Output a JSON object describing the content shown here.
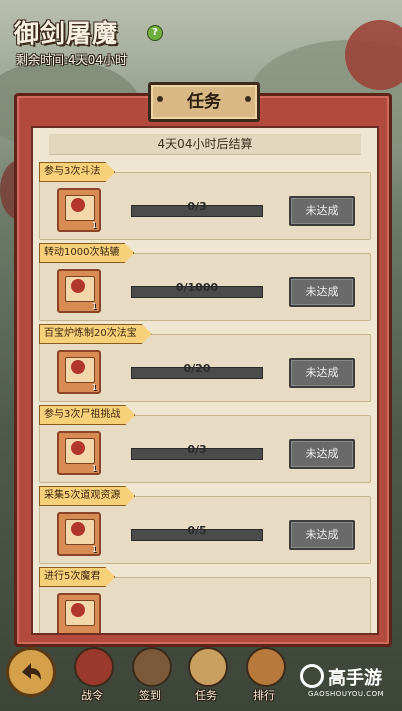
{
  "header": {
    "game_title": "御剑屠魔",
    "help_icon": "?",
    "remaining_time": "剩余时间:4天04小时"
  },
  "panel": {
    "title": "任务",
    "settle_text": "4天04小时后结算"
  },
  "tasks": [
    {
      "label": "参与3次斗法",
      "reward_qty": "1",
      "progress": "0/3",
      "button": "未达成"
    },
    {
      "label": "转动1000次轱辘",
      "reward_qty": "1",
      "progress": "0/1000",
      "button": "未达成"
    },
    {
      "label": "百宝炉炼制20次法宝",
      "reward_qty": "1",
      "progress": "0/20",
      "button": "未达成"
    },
    {
      "label": "参与3次尸祖挑战",
      "reward_qty": "1",
      "progress": "0/3",
      "button": "未达成"
    },
    {
      "label": "采集5次道观资源",
      "reward_qty": "1",
      "progress": "0/5",
      "button": "未达成"
    },
    {
      "label": "进行5次魔君"
    }
  ],
  "bottom_nav": [
    {
      "label": "战令",
      "color": "#9a3a2c"
    },
    {
      "label": "签到",
      "color": "#7a5a3a"
    },
    {
      "label": "任务",
      "color": "#c9a060"
    },
    {
      "label": "排行",
      "color": "#b77a3c"
    }
  ],
  "watermark": {
    "brand": "高手游",
    "url": "GAOSHOUYOU.COM"
  }
}
